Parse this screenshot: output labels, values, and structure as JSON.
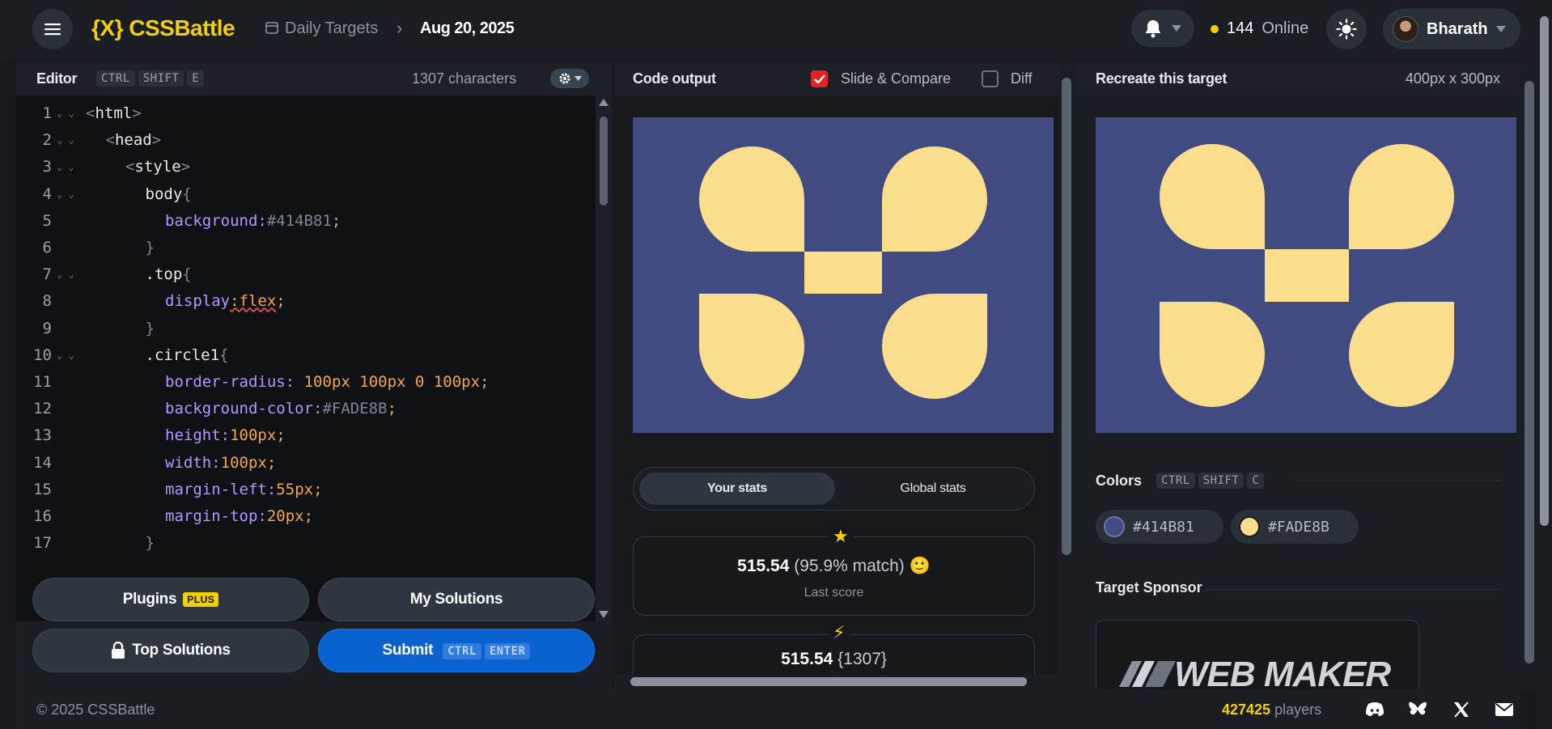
{
  "header": {
    "logo": "{X} CSSBattle",
    "breadcrumb_parent": "Daily Targets",
    "breadcrumb_current": "Aug 20, 2025",
    "online_count": "144",
    "online_label": "Online",
    "user_name": "Bharath"
  },
  "editor": {
    "title": "Editor",
    "shortcut_keys": [
      "CTRL",
      "SHIFT",
      "E"
    ],
    "char_count": "1307 characters",
    "lines": [
      {
        "n": "1",
        "fold": true,
        "indent": 0,
        "html": "<span class='t-punc'>&lt;</span><span class='t-tag'>html</span><span class='t-punc'>&gt;</span>"
      },
      {
        "n": "2",
        "fold": true,
        "indent": 1,
        "html": "<span class='t-punc'>&lt;</span><span class='t-tag'>head</span><span class='t-punc'>&gt;</span>"
      },
      {
        "n": "3",
        "fold": true,
        "indent": 2,
        "html": "<span class='t-punc'>&lt;</span><span class='t-tag'>style</span><span class='t-punc'>&gt;</span>"
      },
      {
        "n": "4",
        "fold": true,
        "indent": 3,
        "html": "<span class='t-sel'>body</span><span class='t-punc'>{</span>"
      },
      {
        "n": "5",
        "fold": false,
        "indent": 4,
        "html": "<span class='t-prop'>background</span><span class='t-prop'>:</span><span class='t-punc'>#414B81</span><span class='t-num'>;</span>"
      },
      {
        "n": "6",
        "fold": false,
        "indent": 3,
        "html": "<span class='t-punc'>}</span>"
      },
      {
        "n": "7",
        "fold": true,
        "indent": 3,
        "html": "<span class='t-sel'>.top</span><span class='t-punc'>{</span>"
      },
      {
        "n": "8",
        "fold": false,
        "indent": 4,
        "html": "<span class='t-prop'>display</span><span class='t-err'>:flex</span><span class='t-num'>;</span>"
      },
      {
        "n": "9",
        "fold": false,
        "indent": 3,
        "html": "<span class='t-punc'>}</span>"
      },
      {
        "n": "10",
        "fold": true,
        "indent": 3,
        "html": "<span class='t-sel'>.circle1</span><span class='t-punc'>{</span>"
      },
      {
        "n": "11",
        "fold": false,
        "indent": 4,
        "html": "<span class='t-prop'>border-radius</span><span class='t-prop'>: </span><span class='t-num'>100</span><span class='t-num'>px </span><span class='t-num'>100</span><span class='t-num'>px </span><span class='t-num'>0 </span><span class='t-num'>100</span><span class='t-num'>px;</span>"
      },
      {
        "n": "12",
        "fold": false,
        "indent": 4,
        "html": "<span class='t-prop'>background-color</span><span class='t-prop'>:</span><span class='t-punc'>#FADE8B</span><span class='t-num'>;</span>"
      },
      {
        "n": "13",
        "fold": false,
        "indent": 4,
        "html": "<span class='t-prop'>height</span><span class='t-prop'>:</span><span class='t-num'>100</span><span class='t-num'>px;</span>"
      },
      {
        "n": "14",
        "fold": false,
        "indent": 4,
        "html": "<span class='t-prop'>width</span><span class='t-prop'>:</span><span class='t-num'>100</span><span class='t-num'>px;</span>"
      },
      {
        "n": "15",
        "fold": false,
        "indent": 4,
        "html": "<span class='t-prop'>margin-left</span><span class='t-prop'>:</span><span class='t-num'>55</span><span class='t-num'>px;</span>"
      },
      {
        "n": "16",
        "fold": false,
        "indent": 4,
        "html": "<span class='t-prop'>margin-top</span><span class='t-prop'>:</span><span class='t-num'>20</span><span class='t-num'>px;</span>"
      },
      {
        "n": "17",
        "fold": false,
        "indent": 3,
        "html": "<span class='t-punc'>}</span>"
      }
    ],
    "buttons": {
      "plugins": "Plugins",
      "plugins_badge": "PLUS",
      "my_solutions": "My Solutions",
      "top_solutions": "Top Solutions",
      "submit": "Submit",
      "submit_keys": [
        "CTRL",
        "ENTER"
      ]
    }
  },
  "output": {
    "title": "Code output",
    "slide_compare_label": "Slide & Compare",
    "slide_compare_checked": true,
    "diff_label": "Diff",
    "diff_checked": false,
    "tabs": [
      "Your stats",
      "Global stats"
    ],
    "last_score": "515.54",
    "last_match": "(95.9% match)",
    "last_score_label": "Last score",
    "best_score": "515.54",
    "best_chars": "{1307}"
  },
  "target": {
    "title": "Recreate this target",
    "size": "400px x 300px",
    "colors_title": "Colors",
    "colors_keys": [
      "CTRL",
      "SHIFT",
      "C"
    ],
    "colors": [
      "#414B81",
      "#FADE8B"
    ],
    "sponsor_title": "Target Sponsor",
    "sponsor_logo_text": "WEB MAKER"
  },
  "footer": {
    "copyright": "© 2025 CSSBattle",
    "players_count": "427425",
    "players_label": "players"
  }
}
